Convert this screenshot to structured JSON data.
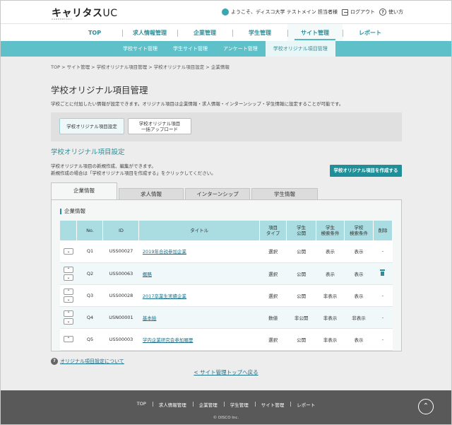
{
  "header": {
    "logo_main": "キャリタス",
    "logo_uc": "UC",
    "logo_sub": "CAREERTASU",
    "user_greeting": "ようこそ、ディスコ大学  テストメイン  担当者様",
    "logout_label": "ログアウト",
    "help_label": "使い方"
  },
  "mainnav": [
    "TOP",
    "求人情報管理",
    "企業管理",
    "学生管理",
    "サイト管理",
    "レポート"
  ],
  "subnav": [
    "学校サイト管理",
    "学生サイト管理",
    "アンケート管理",
    "学校オリジナル項目管理"
  ],
  "breadcrumb": "TOP > サイト管理 > 学校オリジナル項目管理 > 学校オリジナル項目設定 > 企業情報",
  "page": {
    "title": "学校オリジナル項目管理",
    "description": "学校ごとに付加したい情報が設定できます。オリジナル項目は企業情報・求人情報・インターンシップ・学生情報に設定することが可能です。"
  },
  "toolbox": {
    "btn1": "学校オリジナル項目設定",
    "btn2_line1": "学校オリジナル項目",
    "btn2_line2": "一括アップロード"
  },
  "section": {
    "title": "学校オリジナル項目設定",
    "desc1": "学校オリジナル項目の新規作成、編集ができます。",
    "desc2": "新規作成の場合は「学校オリジナル項目を作成する」をクリックしてください。",
    "create_button": "学校オリジナル項目を作成する"
  },
  "tabs": [
    "企業情報",
    "求人情報",
    "インターンシップ",
    "学生情報"
  ],
  "panel_title": "企業情報",
  "table": {
    "headers": {
      "no": "No.",
      "id": "ID",
      "title": "タイトル",
      "type_l1": "項目",
      "type_l2": "タイプ",
      "pub_l1": "学生",
      "pub_l2": "公開",
      "scond_l1": "学生",
      "scond_l2": "検索条件",
      "gcond_l1": "学校",
      "gcond_l2": "検索条件",
      "delete": "削除"
    },
    "rows": [
      {
        "no": "Q1",
        "id": "USS00027",
        "title": "2019年合説参加企業",
        "type": "選択",
        "pub": "公開",
        "scond": "表示",
        "gcond": "表示",
        "del": "-"
      },
      {
        "no": "Q2",
        "id": "USS00063",
        "title": "概略",
        "type": "選択",
        "pub": "公開",
        "scond": "表示",
        "gcond": "表示",
        "del": ""
      },
      {
        "no": "Q3",
        "id": "USS00028",
        "title": "2017卒業生実績企業",
        "type": "選択",
        "pub": "公開",
        "scond": "非表示",
        "gcond": "表示",
        "del": "-"
      },
      {
        "no": "Q4",
        "id": "USN00001",
        "title": "基本給",
        "type": "数値",
        "pub": "非公開",
        "scond": "非表示",
        "gcond": "非表示",
        "del": "-"
      },
      {
        "no": "Q5",
        "id": "USS00003",
        "title": "学内企業研究会参加履歴",
        "type": "選択",
        "pub": "公開",
        "scond": "非表示",
        "gcond": "表示",
        "del": "-"
      }
    ]
  },
  "help_link": "オリジナル項目設定について",
  "back_link": "< サイト管理トップへ戻る",
  "footer": {
    "links": [
      "TOP",
      "求人情報管理",
      "企業管理",
      "学生管理",
      "サイト管理",
      "レポート"
    ],
    "copyright": "© DISCO Inc."
  },
  "icons": {
    "user": "user-icon",
    "logout": "logout-icon",
    "help": "help-icon",
    "trash": "trash-icon",
    "totop": "chevron-up-icon"
  },
  "colors": {
    "accent": "#2c8e98",
    "subnav": "#5ec1c9",
    "table_header": "#a9dde1",
    "footer": "#595959"
  }
}
